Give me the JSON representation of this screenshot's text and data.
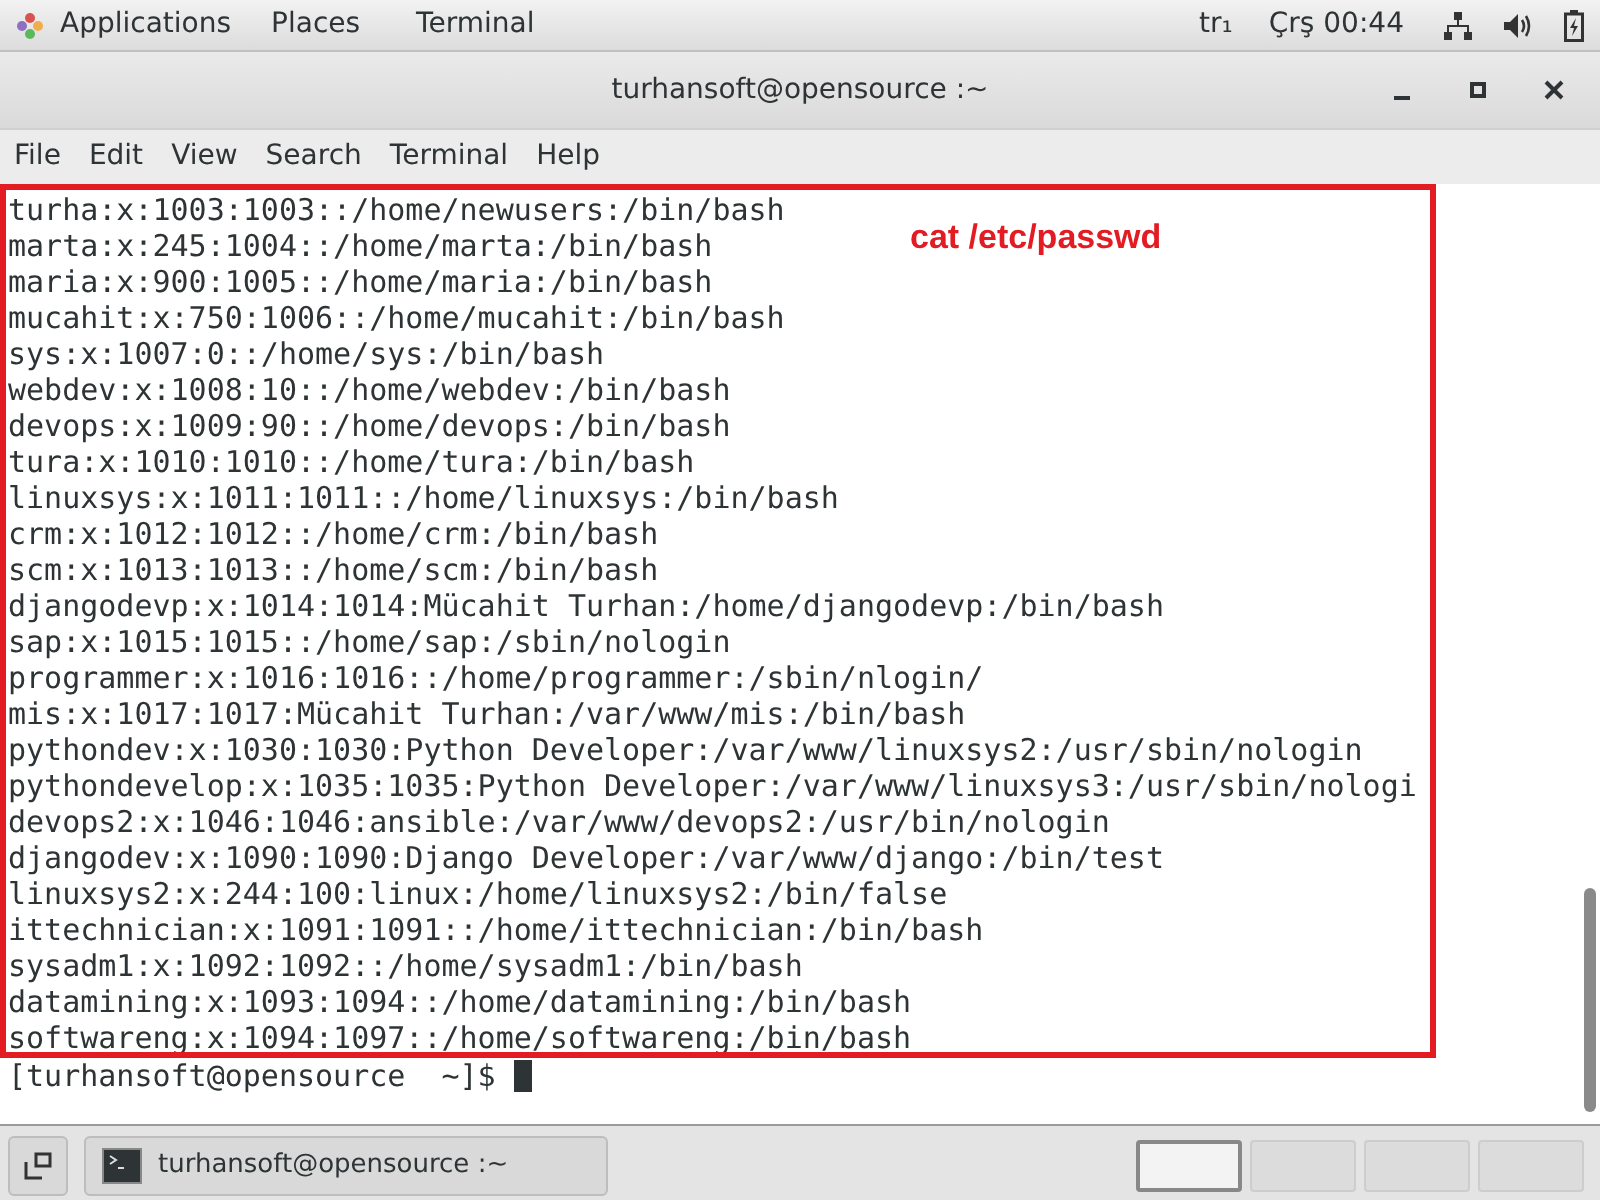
{
  "top_bar": {
    "menus": [
      "Applications",
      "Places",
      "Terminal"
    ],
    "keyboard_layout": "tr₁",
    "clock": "Çrş 00:44"
  },
  "window": {
    "title": "turhansoft@opensource :~"
  },
  "menu_bar": [
    "File",
    "Edit",
    "View",
    "Search",
    "Terminal",
    "Help"
  ],
  "annotation": "cat /etc/passwd",
  "terminal_lines": [
    "turha:x:1003:1003::/home/newusers:/bin/bash",
    "marta:x:245:1004::/home/marta:/bin/bash",
    "maria:x:900:1005::/home/maria:/bin/bash",
    "mucahit:x:750:1006::/home/mucahit:/bin/bash",
    "sys:x:1007:0::/home/sys:/bin/bash",
    "webdev:x:1008:10::/home/webdev:/bin/bash",
    "devops:x:1009:90::/home/devops:/bin/bash",
    "tura:x:1010:1010::/home/tura:/bin/bash",
    "linuxsys:x:1011:1011::/home/linuxsys:/bin/bash",
    "crm:x:1012:1012::/home/crm:/bin/bash",
    "scm:x:1013:1013::/home/scm:/bin/bash",
    "djangodevp:x:1014:1014:Mücahit Turhan:/home/djangodevp:/bin/bash",
    "sap:x:1015:1015::/home/sap:/sbin/nologin",
    "programmer:x:1016:1016::/home/programmer:/sbin/nlogin/",
    "mis:x:1017:1017:Mücahit Turhan:/var/www/mis:/bin/bash",
    "pythondev:x:1030:1030:Python Developer:/var/www/linuxsys2:/usr/sbin/nologin",
    "pythondevelop:x:1035:1035:Python Developer:/var/www/linuxsys3:/usr/sbin/nologi",
    "devops2:x:1046:1046:ansible:/var/www/devops2:/usr/bin/nologin",
    "djangodev:x:1090:1090:Django Developer:/var/www/django:/bin/test",
    "linuxsys2:x:244:100:linux:/home/linuxsys2:/bin/false",
    "ittechnician:x:1091:1091::/home/ittechnician:/bin/bash",
    "sysadm1:x:1092:1092::/home/sysadm1:/bin/bash",
    "datamining:x:1093:1094::/home/datamining:/bin/bash",
    "softwareng:x:1094:1097::/home/softwareng:/bin/bash"
  ],
  "prompt": "[turhansoft@opensource  ~]$",
  "taskbar": {
    "task": "turhansoft@opensource :~",
    "workspaces": [
      {
        "selected": true
      },
      {
        "selected": false
      },
      {
        "selected": false
      },
      {
        "selected": false
      }
    ]
  }
}
